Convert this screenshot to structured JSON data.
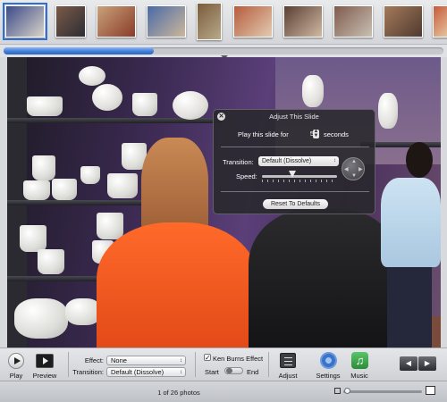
{
  "filmstrip": {
    "thumbs": [
      {
        "colors": [
          "#3b4a8a",
          "#d9d3c8"
        ]
      },
      {
        "colors": [
          "#7a5a48",
          "#2d2d33"
        ]
      },
      {
        "colors": [
          "#c9a27a",
          "#8a3b2a"
        ]
      },
      {
        "colors": [
          "#4a6aa8",
          "#ccb79a"
        ]
      },
      {
        "colors": [
          "#7a5c3a",
          "#b8a98c"
        ]
      },
      {
        "colors": [
          "#b65c3c",
          "#e2cbb2"
        ]
      },
      {
        "colors": [
          "#5a3f33",
          "#d1b9a3"
        ]
      },
      {
        "colors": [
          "#7e5b4c",
          "#c9c0b4"
        ]
      },
      {
        "colors": [
          "#a47a5a",
          "#4f3a30"
        ]
      },
      {
        "colors": [
          "#c65a3a",
          "#e7c9a4"
        ]
      },
      {
        "colors": [
          "#6b4a3d",
          "#caa48a"
        ]
      }
    ]
  },
  "adjust": {
    "title": "Adjust This Slide",
    "close_icon": "close-icon",
    "play_for_label": "Play this slide for",
    "duration_value": "5",
    "duration_unit": "seconds",
    "transition_label": "Transition:",
    "transition_value": "Default (Dissolve)",
    "speed_label": "Speed:",
    "reset_label": "Reset To Defaults"
  },
  "toolbar": {
    "play_label": "Play",
    "preview_label": "Preview",
    "effect_label": "Effect:",
    "effect_value": "None",
    "transition_label": "Transition:",
    "transition_value": "Default (Dissolve)",
    "ken_burns_label": "Ken Burns Effect",
    "ken_burns_checked": "✓",
    "start_label": "Start",
    "end_label": "End",
    "adjust_label": "Adjust",
    "settings_label": "Settings",
    "music_label": "Music",
    "music_glyph": "♫",
    "prev_glyph": "◀",
    "next_glyph": "▶"
  },
  "status": {
    "photo_count": "1 of 26 photos"
  },
  "colors": {
    "accent": "#3d7bd6",
    "panel_bg": "#28282c"
  }
}
